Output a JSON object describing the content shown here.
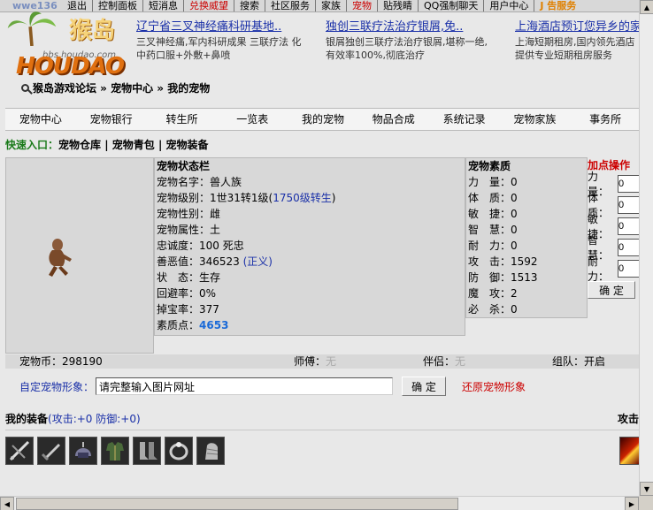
{
  "topbar": {
    "site": "wwe136",
    "links": [
      {
        "label": "退出",
        "style": ""
      },
      {
        "label": "控制面板",
        "style": ""
      },
      {
        "label": "短消息",
        "style": ""
      },
      {
        "label": "兑换威望",
        "style": "red"
      },
      {
        "label": "搜索",
        "style": ""
      },
      {
        "label": "社区服务",
        "style": ""
      },
      {
        "label": "家族",
        "style": ""
      },
      {
        "label": "宠物",
        "style": "red"
      },
      {
        "label": "贴残睛",
        "style": ""
      },
      {
        "label": "QQ强制聊天",
        "style": ""
      },
      {
        "label": "用户中心",
        "style": ""
      },
      {
        "label": "J 告服务",
        "style": "orange"
      }
    ]
  },
  "logo": {
    "chars": "猴岛",
    "text": "HOUDAO",
    "domain": "bbs.houdao.com"
  },
  "ads": [
    {
      "title": "辽宁省三叉神经痛科研基地..",
      "desc": "三叉神经痛,军内科研成果 三联疗法 化中药口服+外敷+鼻喷"
    },
    {
      "title": "独创三联疗法治疗银屑,免..",
      "desc": "银屑独创三联疗法治疗银屑,堪称一绝,有效率100%,彻底治疗"
    },
    {
      "title": "上海酒店预订您异乡的家",
      "desc": "上海短期租房,国内领先酒店提供专业短期租房服务"
    }
  ],
  "breadcrumb": "猴岛游戏论坛 » 宠物中心 » 我的宠物",
  "nav": [
    "宠物中心",
    "宠物银行",
    "转生所",
    "一览表",
    "我的宠物",
    "物品合成",
    "系统记录",
    "宠物家族",
    "事务所"
  ],
  "quick": {
    "label": "快速入口：",
    "items": [
      "宠物仓库",
      "宠物青包",
      "宠物装备"
    ]
  },
  "status": {
    "title": "宠物状态栏",
    "name": "宠物名字：兽人族",
    "level_prefix": "宠物级别：1世31转1级(",
    "level_link": "1750级转生",
    "level_suffix": ")",
    "gender": "宠物性别：雌",
    "element": "宠物属性：土",
    "loyalty": "忠诚度：100 死忠",
    "karma_prefix": "善恶值：346523 ",
    "karma_link": "(正义)",
    "state": "状　态：生存",
    "dodge": "回避率：0%",
    "drop": "掉宝率：377",
    "points_label": "素质点：",
    "points_value": "4653"
  },
  "attrs": {
    "title": "宠物素质",
    "rows": [
      "力　量：0",
      "体　质：0",
      "敏　捷：0",
      "智　慧：0",
      "耐　力：0",
      "攻　击：1592",
      "防　御：1513",
      "魔　攻：2",
      "必　杀：0"
    ]
  },
  "addpoints": {
    "title": "加点操作",
    "rows": [
      "力量：",
      "体质：",
      "敏捷：",
      "智慧：",
      "耐力："
    ],
    "value": "0",
    "confirm": "确 定"
  },
  "infobar": {
    "coins": "宠物币：298190",
    "master_label": "师傅：",
    "master_value": "无",
    "partner_label": "伴侣：",
    "partner_value": "无",
    "group_label": "组队：",
    "group_value": "开启"
  },
  "form": {
    "label": "自定宠物形象：",
    "value": "请完整输入图片网址",
    "confirm": "确 定",
    "restore": "还原宠物形象"
  },
  "equipment": {
    "title": "我的装备",
    "stats": "(攻击:+0 防御:+0)",
    "attack": "攻击",
    "items": [
      "crossbow-icon",
      "dagger-icon",
      "helmet-icon",
      "armor-icon",
      "boots-icon",
      "ring-icon",
      "gauntlet-icon"
    ]
  }
}
